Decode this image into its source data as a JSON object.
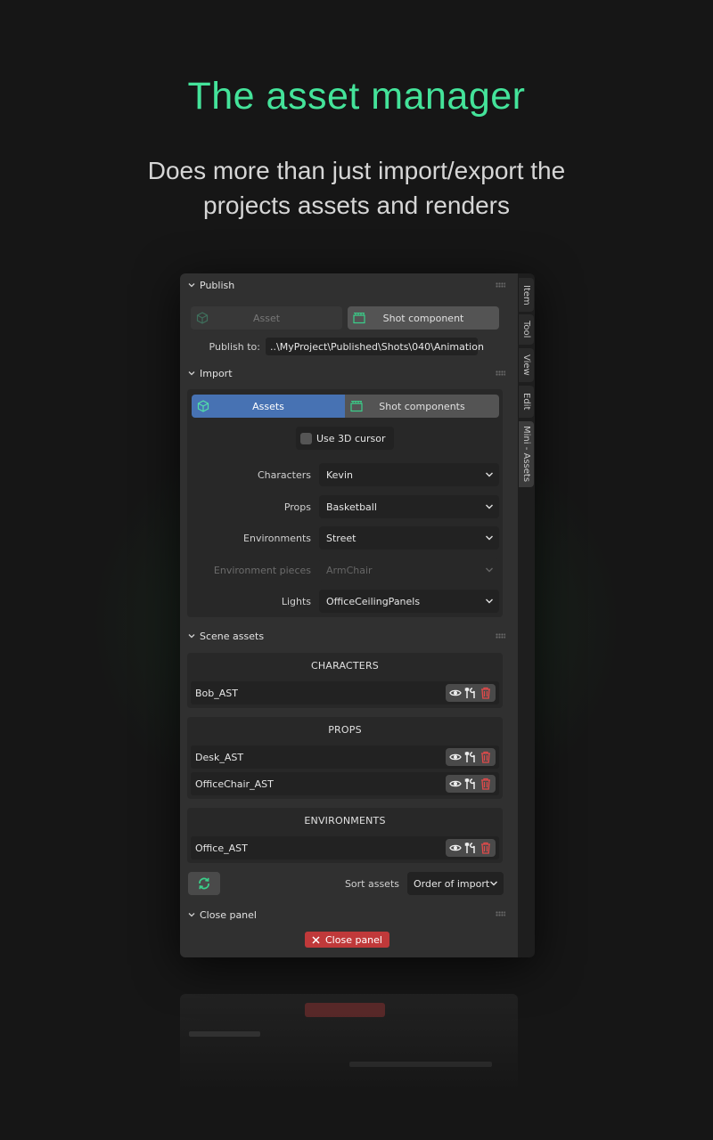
{
  "hero": {
    "title": "The asset manager",
    "subtitle": "Does more than just import/export the projects assets and renders"
  },
  "side_tabs": [
    "Item",
    "Tool",
    "View",
    "Edit",
    "Mini - Assets"
  ],
  "publish": {
    "header": "Publish",
    "asset_button": "Asset",
    "shot_component_button": "Shot component",
    "publish_to_label": "Publish to:",
    "publish_to_value": "..\\MyProject\\Published\\Shots\\040\\Animation"
  },
  "import": {
    "header": "Import",
    "tab_assets": "Assets",
    "tab_shot_components": "Shot components",
    "use_3d_cursor": "Use 3D cursor",
    "fields": [
      {
        "label": "Characters",
        "value": "Kevin",
        "enabled": true
      },
      {
        "label": "Props",
        "value": "Basketball",
        "enabled": true
      },
      {
        "label": "Environments",
        "value": "Street",
        "enabled": true
      },
      {
        "label": "Environment pieces",
        "value": "ArmChair",
        "enabled": false
      },
      {
        "label": "Lights",
        "value": "OfficeCeilingPanels",
        "enabled": true
      }
    ]
  },
  "scene_assets": {
    "header": "Scene assets",
    "groups": [
      {
        "title": "CHARACTERS",
        "items": [
          "Bob_AST"
        ]
      },
      {
        "title": "PROPS",
        "items": [
          "Desk_AST",
          "OfficeChair_AST"
        ]
      },
      {
        "title": "ENVIRONMENTS",
        "items": [
          "Office_AST"
        ]
      }
    ],
    "sort_label": "Sort assets",
    "sort_value": "Order of import"
  },
  "close": {
    "header": "Close panel",
    "button": "Close panel"
  },
  "colors": {
    "accent_green": "#44e39a",
    "blue_tab": "#4772b3",
    "delete_red": "#c0393a"
  }
}
